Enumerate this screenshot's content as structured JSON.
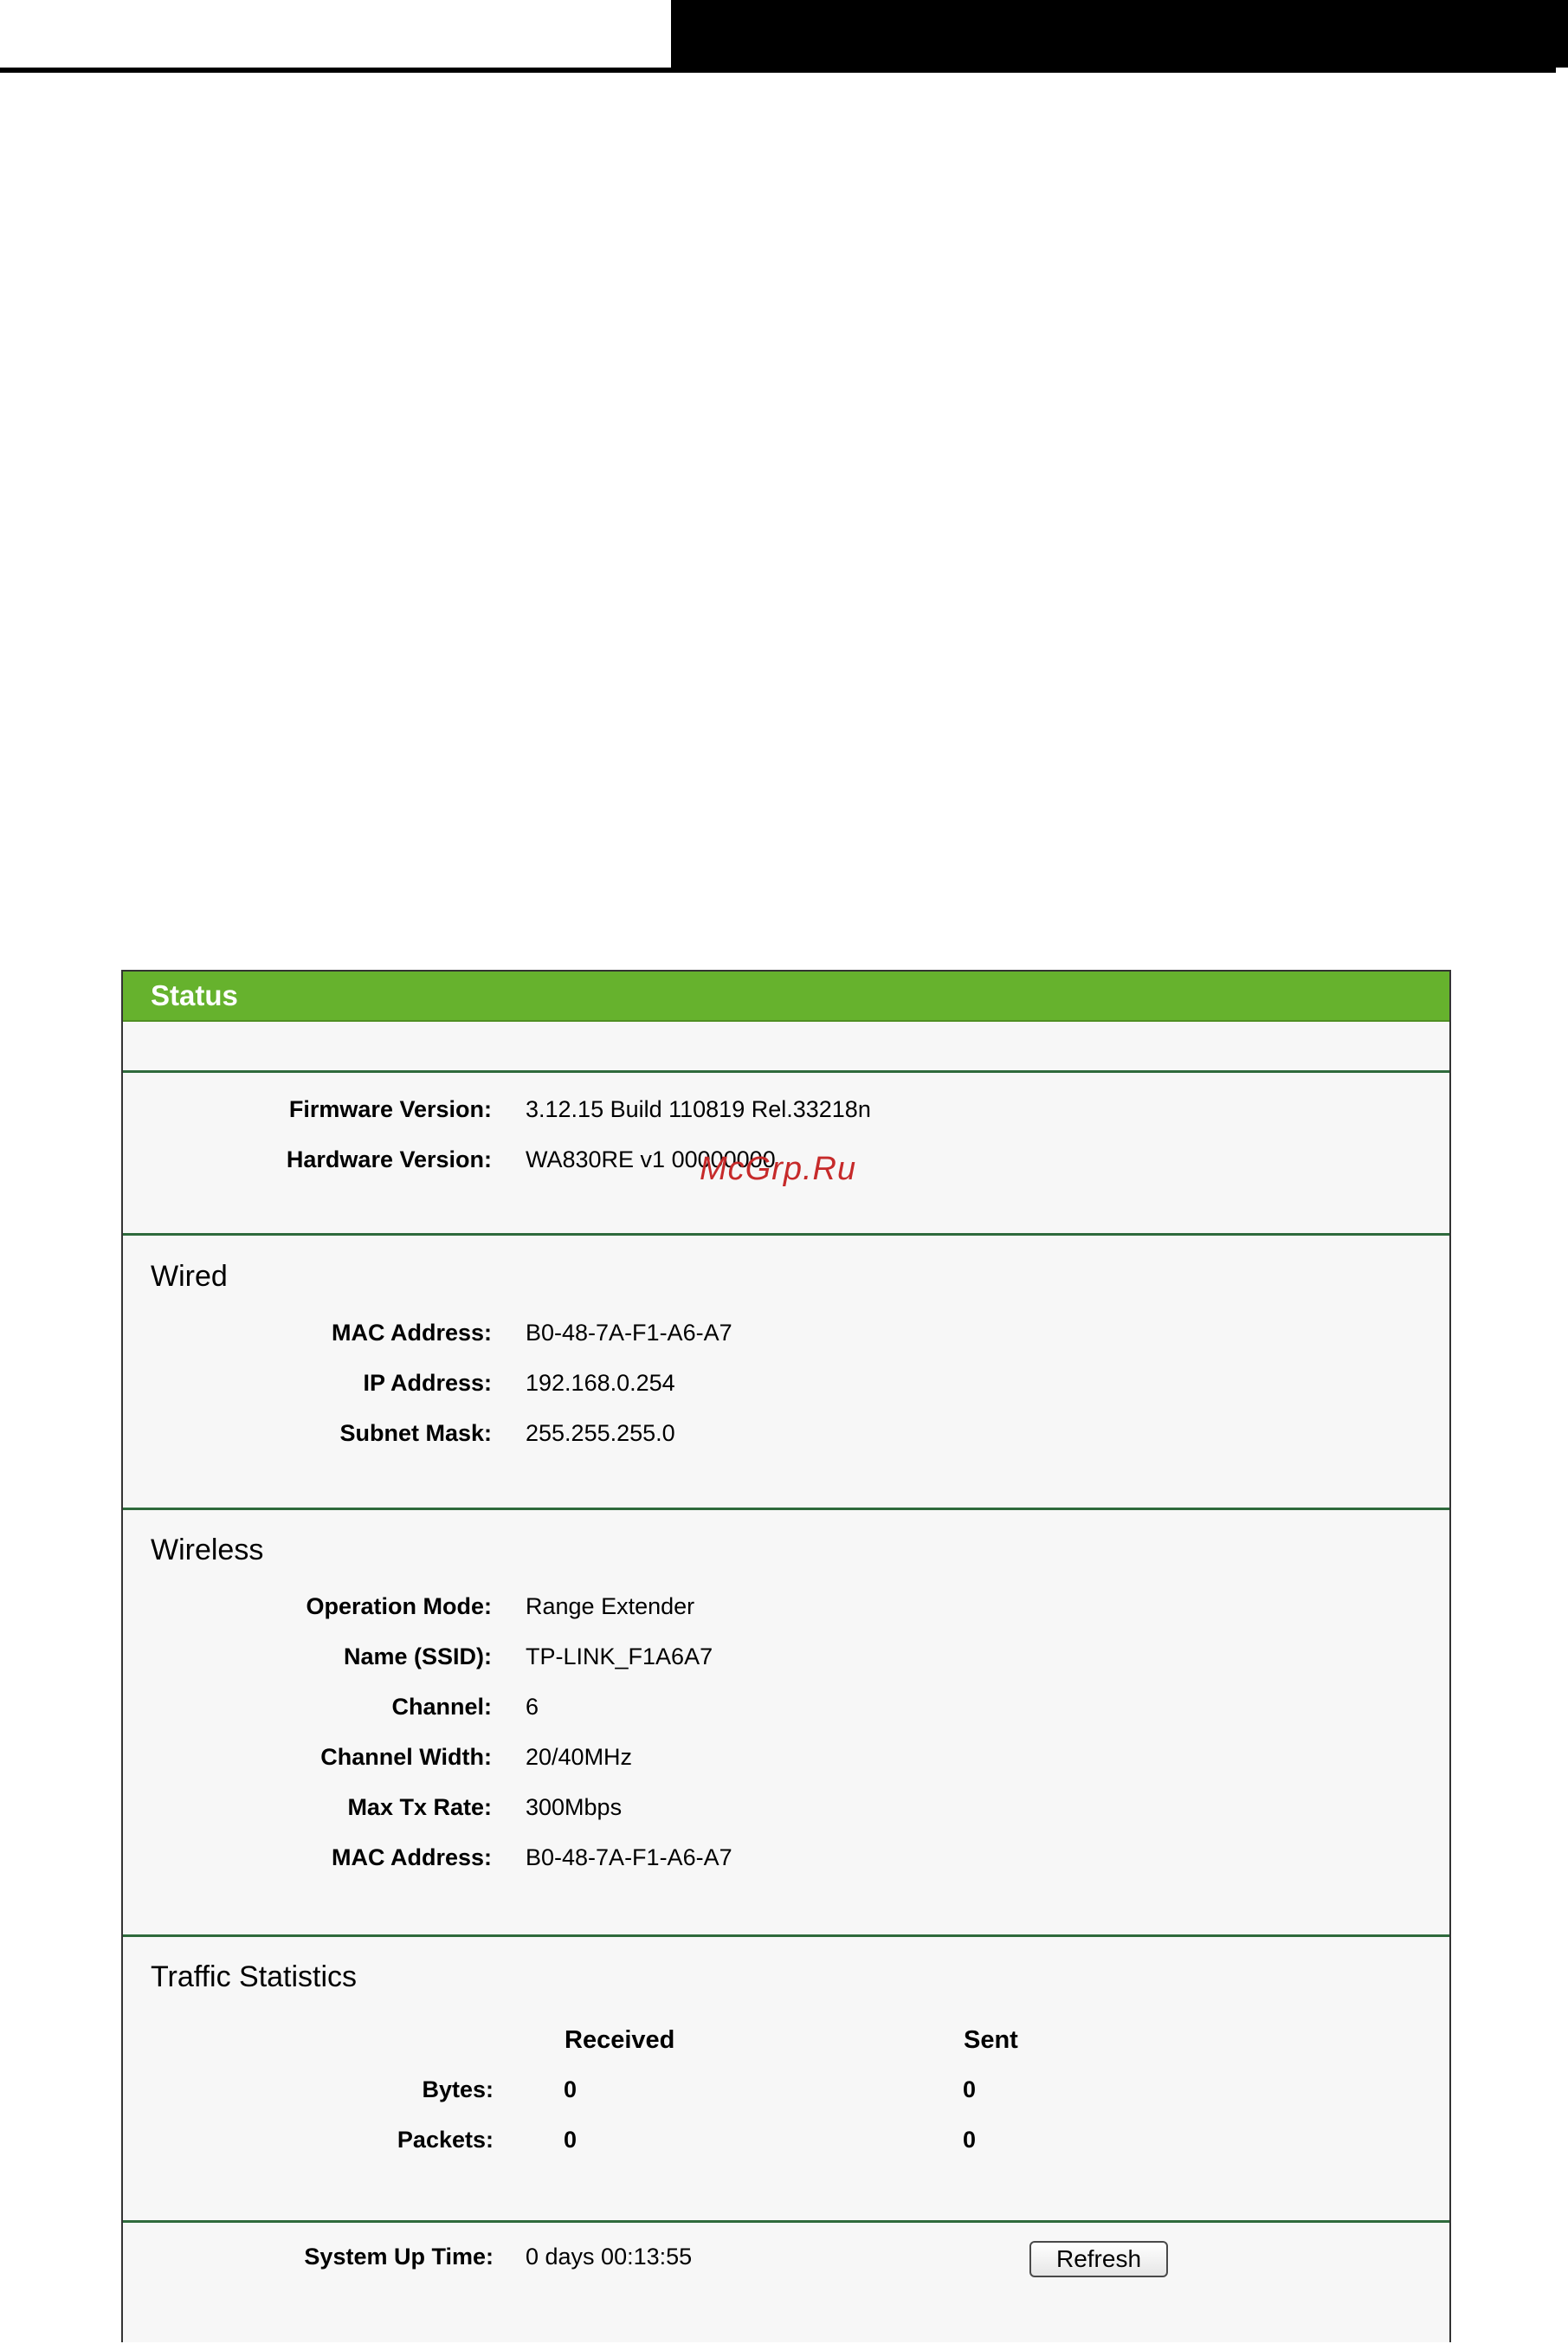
{
  "status_panel": {
    "title": "Status",
    "general": {
      "firmware_label": "Firmware Version:",
      "firmware_value": "3.12.15 Build 110819 Rel.33218n",
      "hardware_label": "Hardware Version:",
      "hardware_value": "WA830RE v1 00000000"
    },
    "wired": {
      "title": "Wired",
      "mac_label": "MAC Address:",
      "mac_value": "B0-48-7A-F1-A6-A7",
      "ip_label": "IP Address:",
      "ip_value": "192.168.0.254",
      "mask_label": "Subnet Mask:",
      "mask_value": "255.255.255.0"
    },
    "wireless": {
      "title": "Wireless",
      "mode_label": "Operation Mode:",
      "mode_value": "Range Extender",
      "ssid_label": "Name (SSID):",
      "ssid_value": "TP-LINK_F1A6A7",
      "channel_label": "Channel:",
      "channel_value": "6",
      "width_label": "Channel Width:",
      "width_value": "20/40MHz",
      "rate_label": "Max Tx Rate:",
      "rate_value": "300Mbps",
      "mac_label": "MAC Address:",
      "mac_value": "B0-48-7A-F1-A6-A7"
    },
    "traffic": {
      "title": "Traffic Statistics",
      "received_header": "Received",
      "sent_header": "Sent",
      "bytes_label": "Bytes:",
      "bytes_received": "0",
      "bytes_sent": "0",
      "packets_label": "Packets:",
      "packets_received": "0",
      "packets_sent": "0"
    },
    "uptime": {
      "label": "System Up Time:",
      "value": "0 days 00:13:55",
      "refresh_button": "Refresh"
    }
  },
  "watermark": "McGrp.Ru",
  "colors": {
    "header_green": "#66b22d",
    "divider_green": "#2e6a3c",
    "panel_background": "#f7f7f7"
  }
}
